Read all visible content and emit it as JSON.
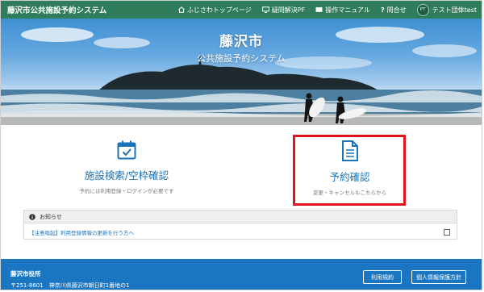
{
  "header": {
    "title": "藤沢市公共施設予約システム",
    "nav": [
      {
        "label": "ふじさわトップページ",
        "icon": "home-icon"
      },
      {
        "label": "疑問解決PF",
        "icon": "monitor-icon"
      },
      {
        "label": "操作マニュアル",
        "icon": "book-icon"
      },
      {
        "label": "問合せ",
        "icon": "question-icon"
      }
    ],
    "user": {
      "initials": "PT",
      "name": "テスト団体test"
    }
  },
  "hero": {
    "title": "藤沢市",
    "subtitle": "公共施設予約システム"
  },
  "cards": [
    {
      "title": "施設検索/空枠確認",
      "note": "予約には利用登録・ログインが必要です",
      "icon": "calendar-check-icon"
    },
    {
      "title": "予約確認",
      "note": "変更・キャンセルもこちらから",
      "icon": "document-icon"
    }
  ],
  "notice": {
    "heading": "お知らせ",
    "items": [
      {
        "text": "【注意喚起】利用登録情報の更新を行う方へ"
      }
    ]
  },
  "footer": {
    "org": "藤沢市役所",
    "address": "〒251-8601　神奈川県藤沢市朝日町1番地の1",
    "buttons": [
      "利用規約",
      "個人情報保護方針"
    ]
  },
  "colors": {
    "header_bg": "#2f7d5b",
    "accent": "#1a73b8",
    "highlight": "#e1131c",
    "footer_bg": "#1b76c2"
  }
}
